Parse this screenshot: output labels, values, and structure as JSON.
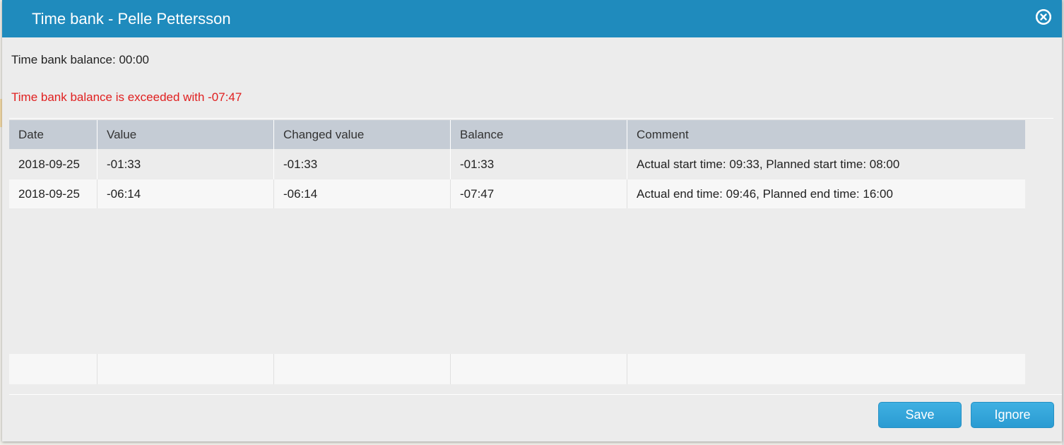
{
  "dialog": {
    "title": "Time bank - Pelle Pettersson"
  },
  "summary": {
    "balance_text": "Time bank balance: 00:00",
    "warning_text": "Time bank balance is exceeded with -07:47"
  },
  "table": {
    "columns": [
      "Date",
      "Value",
      "Changed value",
      "Balance",
      "Comment"
    ],
    "rows": [
      [
        "2018-09-25",
        "-01:33",
        "-01:33",
        "-01:33",
        "Actual start time: 09:33, Planned start time: 08:00"
      ],
      [
        "2018-09-25",
        "-06:14",
        "-06:14",
        "-07:47",
        "Actual end time: 09:46, Planned end time: 16:00"
      ]
    ]
  },
  "footer": {
    "save_label": "Save",
    "ignore_label": "Ignore"
  },
  "colors": {
    "titlebar": "#1f8bbd",
    "warning": "#e02020",
    "button": "#2a9bd2",
    "header": "#c5ccd5"
  },
  "icons": {
    "close": "close-circle-icon"
  }
}
